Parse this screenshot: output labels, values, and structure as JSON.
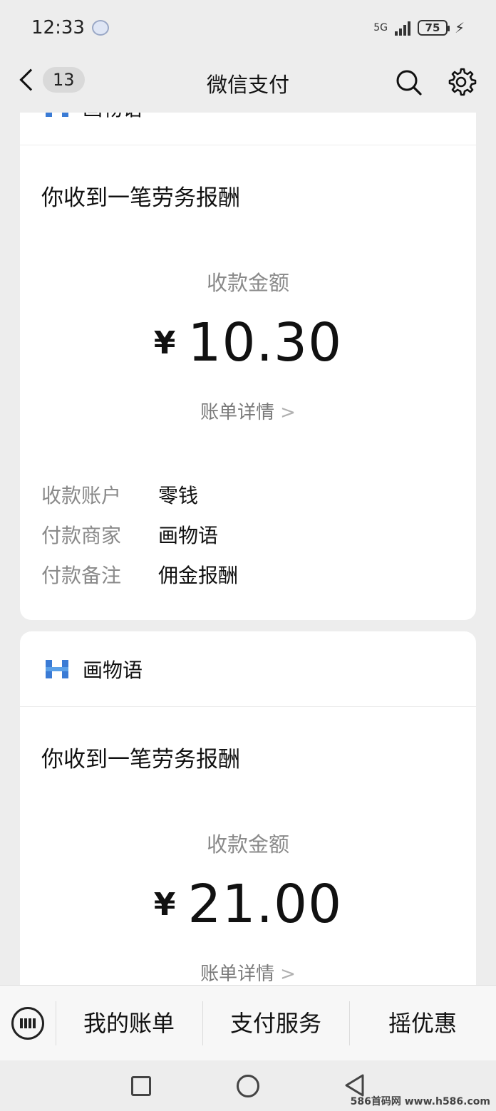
{
  "status_bar": {
    "time": "12:33",
    "network": "5G",
    "battery": "75"
  },
  "nav": {
    "badge": "13",
    "title": "微信支付"
  },
  "cards": [
    {
      "merchant": "画物语",
      "notice": "你收到一笔劳务报酬",
      "amount_label": "收款金额",
      "currency": "¥",
      "amount": "10.30",
      "details_link": "账单详情",
      "fields": [
        {
          "key": "收款账户",
          "value": "零钱"
        },
        {
          "key": "付款商家",
          "value": "画物语"
        },
        {
          "key": "付款备注",
          "value": "佣金报酬"
        }
      ]
    },
    {
      "merchant": "画物语",
      "notice": "你收到一笔劳务报酬",
      "amount_label": "收款金额",
      "currency": "¥",
      "amount": "21.00",
      "details_link": "账单详情"
    }
  ],
  "bottom_menu": [
    "我的账单",
    "支付服务",
    "摇优惠"
  ],
  "watermark": "586首码网 www.h586.com",
  "colors": {
    "background": "#ededed",
    "card": "#ffffff",
    "muted_text": "#8a8a8a",
    "logo_blue": "#3a7bd5"
  }
}
